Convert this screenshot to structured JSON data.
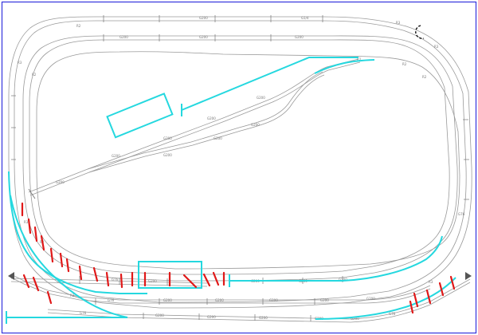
{
  "frame": {
    "border_color": "#3333dd"
  },
  "colors": {
    "track": "#9a9a9a",
    "highlight": "#25d8df",
    "marker": "#e01818"
  },
  "track_labels": {
    "top_outer": [
      "G1/4",
      "G200",
      "R3"
    ],
    "top_inner": [
      "G200",
      "G200",
      "G200",
      "R2"
    ],
    "siding": [
      "G200",
      "G200",
      "G200",
      "G200",
      "G200",
      "G200",
      "G200",
      "G200"
    ],
    "bottom_row1": [
      "G200",
      "G200",
      "G200",
      "G200",
      "G76"
    ],
    "bottom_row2": [
      "G76",
      "G200",
      "G200",
      "G200",
      "G200",
      "G200",
      "R3"
    ],
    "bottom_row3": [
      "G76",
      "G200",
      "G200",
      "G200",
      "G200",
      "G200"
    ],
    "curves": [
      "R2",
      "R2",
      "R3",
      "R2",
      "R2",
      "R3",
      "R2",
      "R3",
      "G76",
      "G76",
      "R3"
    ]
  }
}
